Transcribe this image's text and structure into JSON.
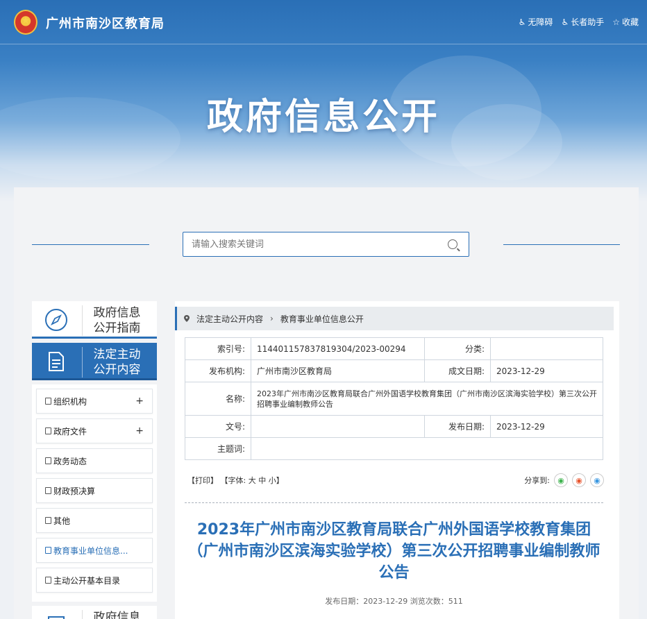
{
  "header": {
    "site_title": "广州市南沙区教育局",
    "links": [
      {
        "label": "无障碍",
        "icon": "accessibility-icon"
      },
      {
        "label": "长者助手",
        "icon": "elder-icon"
      },
      {
        "label": "收藏",
        "icon": "star-icon"
      }
    ]
  },
  "hero": {
    "title": "政府信息公开"
  },
  "search": {
    "placeholder": "请输入搜索关键词"
  },
  "sidebar": {
    "head1": {
      "line1": "政府信息",
      "line2": "公开指南"
    },
    "head2": {
      "line1": "法定主动",
      "line2": "公开内容"
    },
    "items": [
      {
        "label": "组织机构",
        "expand": "+"
      },
      {
        "label": "政府文件",
        "expand": "+"
      },
      {
        "label": "政务动态"
      },
      {
        "label": "财政预决算"
      },
      {
        "label": "其他"
      },
      {
        "label": "教育事业单位信息..."
      },
      {
        "label": "主动公开基本目录"
      }
    ],
    "head3": {
      "line1": "政府信息"
    }
  },
  "breadcrumb": {
    "item1": "法定主动公开内容",
    "separator": "›",
    "item2": "教育事业单位信息公开"
  },
  "info": {
    "index_label": "索引号:",
    "index_value": "114401157837819304/2023-00294",
    "category_label": "分类:",
    "category_value": "",
    "publisher_label": "发布机构:",
    "publisher_value": "广州市南沙区教育局",
    "created_label": "成文日期:",
    "created_value": "2023-12-29",
    "name_label": "名称:",
    "name_value": "2023年广州市南沙区教育局联合广州外国语学校教育集团（广州市南沙区滨海实验学校）第三次公开招聘事业编制教师公告",
    "docno_label": "文号:",
    "docno_value": "",
    "pubdate_label": "发布日期:",
    "pubdate_value": "2023-12-29",
    "keywords_label": "主题词:",
    "keywords_value": ""
  },
  "tools": {
    "print": "【打印】",
    "font": "【字体:",
    "big": "大",
    "mid": "中",
    "small": "小",
    "close": "】"
  },
  "share": {
    "label": "分享到:"
  },
  "article": {
    "title": "2023年广州市南沙区教育局联合广州外国语学校教育集团（广州市南沙区滨海实验学校）第三次公开招聘事业编制教师公告",
    "meta": "发布日期：2023-12-29  浏览次数：511"
  }
}
